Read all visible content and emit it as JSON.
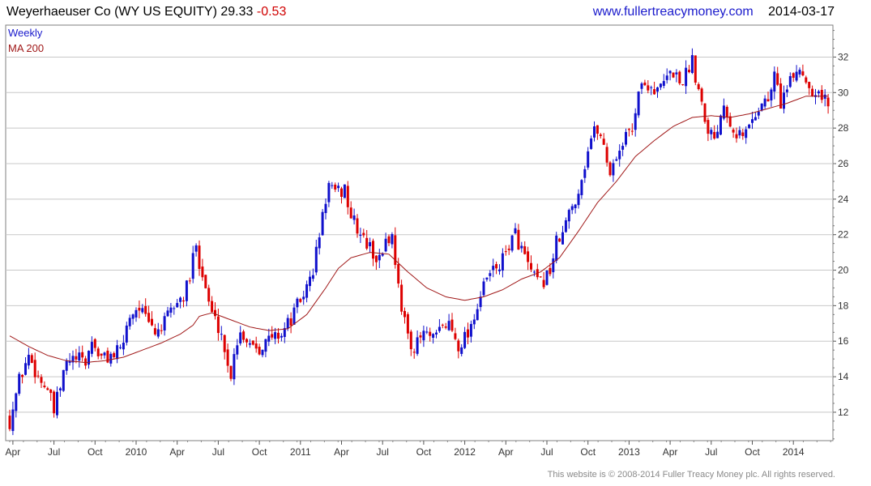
{
  "header": {
    "company": "Weyerhaeuser Co (WY US EQUITY)",
    "last": "29.33",
    "change": "-0.53",
    "website": "www.fullertreacymoney.com",
    "date": "2014-03-17"
  },
  "footer": {
    "copyright": "This website is © 2008-2014 Fuller Treacy Money plc. All rights reserved."
  },
  "colors": {
    "up": "#1010cc",
    "down": "#dd0000",
    "ma": "#a01818",
    "grid": "#c8c8c8",
    "legend_weekly": "#1a1acc",
    "legend_ma": "#a01818"
  },
  "chart_data": {
    "type": "candlestick",
    "frequency": "Weekly",
    "legend": [
      "Weekly",
      "MA 200"
    ],
    "y_ticks": [
      12,
      14,
      16,
      18,
      20,
      22,
      24,
      26,
      28,
      30,
      32
    ],
    "ylim": [
      10.4,
      33.8
    ],
    "x_ticks": [
      "Apr",
      "Jul",
      "Oct",
      "2010",
      "Apr",
      "Jul",
      "Oct",
      "2011",
      "Apr",
      "Jul",
      "Oct",
      "2012",
      "Apr",
      "Jul",
      "Oct",
      "2013",
      "Apr",
      "Jul",
      "Oct",
      "2014"
    ],
    "close_anchors": [
      [
        0,
        11.5
      ],
      [
        3,
        13.8
      ],
      [
        6,
        15.2
      ],
      [
        9,
        14.0
      ],
      [
        12,
        13.3
      ],
      [
        14,
        12.0
      ],
      [
        16,
        13.4
      ],
      [
        18,
        14.8
      ],
      [
        21,
        15.0
      ],
      [
        24,
        14.8
      ],
      [
        26,
        16.0
      ],
      [
        29,
        15.0
      ],
      [
        32,
        15.2
      ],
      [
        35,
        15.4
      ],
      [
        38,
        17.5
      ],
      [
        41,
        18.0
      ],
      [
        43,
        17.2
      ],
      [
        46,
        16.5
      ],
      [
        49,
        17.0
      ],
      [
        52,
        18.0
      ],
      [
        55,
        18.5
      ],
      [
        57,
        19.5
      ],
      [
        59,
        21.8
      ],
      [
        60,
        20.5
      ],
      [
        62,
        19.0
      ],
      [
        64,
        17.5
      ],
      [
        67,
        16.5
      ],
      [
        69,
        14.5
      ],
      [
        70,
        14.2
      ],
      [
        71,
        15.5
      ],
      [
        73,
        16.5
      ],
      [
        76,
        16.0
      ],
      [
        79,
        15.7
      ],
      [
        83,
        16.2
      ],
      [
        86,
        16.5
      ],
      [
        89,
        17.2
      ],
      [
        91,
        18.0
      ],
      [
        94,
        19.0
      ],
      [
        96,
        20.0
      ],
      [
        98,
        22.0
      ],
      [
        100,
        24.0
      ],
      [
        101,
        24.8
      ],
      [
        103,
        24.2
      ],
      [
        106,
        24.6
      ],
      [
        108,
        23.0
      ],
      [
        111,
        22.0
      ],
      [
        114,
        21.2
      ],
      [
        117,
        20.5
      ],
      [
        119,
        21.8
      ],
      [
        121,
        21.8
      ],
      [
        123,
        19.5
      ],
      [
        124,
        17.5
      ],
      [
        126,
        16.5
      ],
      [
        128,
        15.5
      ],
      [
        131,
        16.5
      ],
      [
        134,
        16.0
      ],
      [
        137,
        16.8
      ],
      [
        139,
        17.0
      ],
      [
        142,
        15.8
      ],
      [
        145,
        16.5
      ],
      [
        147,
        17.5
      ],
      [
        149,
        18.5
      ],
      [
        151,
        19.5
      ],
      [
        153,
        20.0
      ],
      [
        156,
        20.5
      ],
      [
        158,
        21.5
      ],
      [
        160,
        22.0
      ],
      [
        162,
        21.2
      ],
      [
        164,
        20.2
      ],
      [
        166,
        19.5
      ],
      [
        168,
        19.2
      ],
      [
        171,
        20.0
      ],
      [
        173,
        21.5
      ],
      [
        175,
        22.0
      ],
      [
        177,
        23.2
      ],
      [
        180,
        24.5
      ],
      [
        182,
        26.0
      ],
      [
        184,
        27.5
      ],
      [
        186,
        28.0
      ],
      [
        188,
        27.0
      ],
      [
        190,
        25.5
      ],
      [
        192,
        26.5
      ],
      [
        195,
        27.5
      ],
      [
        197,
        28.0
      ],
      [
        199,
        30.2
      ],
      [
        202,
        30.5
      ],
      [
        205,
        30.0
      ],
      [
        208,
        30.8
      ],
      [
        210,
        31.2
      ],
      [
        212,
        30.6
      ],
      [
        214,
        31.0
      ],
      [
        216,
        32.0
      ],
      [
        217,
        31.0
      ],
      [
        219,
        29.5
      ],
      [
        221,
        28.0
      ],
      [
        223,
        27.5
      ],
      [
        226,
        29.5
      ],
      [
        229,
        28.0
      ],
      [
        232,
        27.5
      ],
      [
        235,
        28.5
      ],
      [
        238,
        29.5
      ],
      [
        240,
        29.5
      ],
      [
        242,
        31.0
      ],
      [
        244,
        29.5
      ],
      [
        247,
        30.5
      ],
      [
        249,
        31.3
      ],
      [
        251,
        31.2
      ],
      [
        253,
        30.3
      ],
      [
        255,
        30.2
      ],
      [
        257,
        29.8
      ],
      [
        259,
        29.33
      ]
    ],
    "ma_anchors": [
      [
        0,
        16.3
      ],
      [
        6,
        15.7
      ],
      [
        12,
        15.2
      ],
      [
        18,
        14.9
      ],
      [
        24,
        14.8
      ],
      [
        30,
        14.9
      ],
      [
        36,
        15.1
      ],
      [
        42,
        15.5
      ],
      [
        48,
        15.9
      ],
      [
        54,
        16.4
      ],
      [
        58,
        16.9
      ],
      [
        60,
        17.4
      ],
      [
        64,
        17.6
      ],
      [
        70,
        17.2
      ],
      [
        76,
        16.8
      ],
      [
        82,
        16.6
      ],
      [
        88,
        16.7
      ],
      [
        94,
        17.5
      ],
      [
        100,
        19.0
      ],
      [
        104,
        20.1
      ],
      [
        108,
        20.7
      ],
      [
        114,
        21.0
      ],
      [
        120,
        20.9
      ],
      [
        126,
        19.9
      ],
      [
        132,
        19.0
      ],
      [
        138,
        18.5
      ],
      [
        144,
        18.3
      ],
      [
        150,
        18.5
      ],
      [
        156,
        18.9
      ],
      [
        162,
        19.5
      ],
      [
        168,
        19.9
      ],
      [
        174,
        20.7
      ],
      [
        180,
        22.2
      ],
      [
        186,
        23.8
      ],
      [
        192,
        25.0
      ],
      [
        198,
        26.4
      ],
      [
        204,
        27.3
      ],
      [
        210,
        28.1
      ],
      [
        216,
        28.6
      ],
      [
        222,
        28.7
      ],
      [
        228,
        28.6
      ],
      [
        234,
        28.8
      ],
      [
        240,
        29.1
      ],
      [
        246,
        29.4
      ],
      [
        252,
        29.8
      ],
      [
        259,
        29.8
      ]
    ],
    "bars": 260
  }
}
